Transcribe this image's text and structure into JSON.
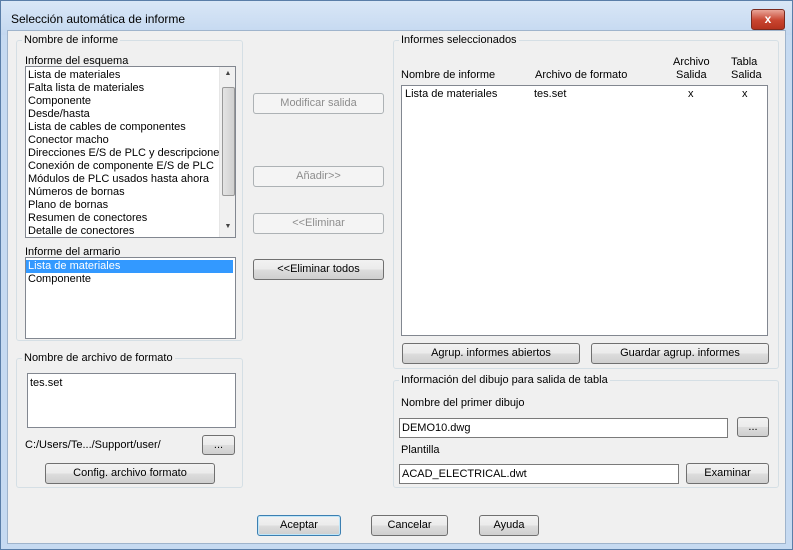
{
  "window": {
    "title": "Selección automática de informe",
    "close_label": "x"
  },
  "left": {
    "report_name_group": "Nombre de informe",
    "schematic_label": "Informe del esquema",
    "schematic_items": [
      "Lista de materiales",
      "Falta lista de materiales",
      "Componente",
      "Desde/hasta",
      "Lista de cables de componentes",
      "Conector macho",
      "Direcciones E/S de PLC y descripciones",
      "Conexión de componente E/S de PLC",
      "Módulos de PLC usados hasta ahora",
      "Números de bornas",
      "Plano de bornas",
      "Resumen de conectores",
      "Detalle de conectores"
    ],
    "panel_label": "Informe del armario",
    "panel_items": [
      "Lista de materiales",
      "Componente"
    ],
    "format_group": "Nombre de archivo de formato",
    "format_items": [
      "tes.set"
    ],
    "path": "C:/Users/Te.../Support/user/",
    "browse_label": "...",
    "config_button": "Config. archivo formato"
  },
  "middle": {
    "modify_output": "Modificar salida",
    "add": "Añadir>>",
    "remove": "<<Eliminar",
    "remove_all": "<<Eliminar todos"
  },
  "right": {
    "selected_group": "Informes seleccionados",
    "col_name": "Nombre de informe",
    "col_format": "Archivo de formato",
    "col_file_1": "Archivo",
    "col_file_2": "Salida",
    "col_table_1": "Tabla",
    "col_table_2": "Salida",
    "rows": [
      {
        "name": "Lista de materiales",
        "format": "tes.set",
        "file": "x",
        "table": "x"
      }
    ],
    "open_group_button": "Agrup. informes abiertos",
    "save_group_button": "Guardar agrup. informes",
    "drawing_group": "Información del dibujo para salida de tabla",
    "first_drawing_label": "Nombre del primer dibujo",
    "first_drawing_value": "DEMO10.dwg",
    "drawing_browse": "...",
    "template_label": "Plantilla",
    "template_value": "ACAD_ELECTRICAL.dwt",
    "template_browse": "Examinar"
  },
  "footer": {
    "ok": "Aceptar",
    "cancel": "Cancelar",
    "help": "Ayuda"
  }
}
